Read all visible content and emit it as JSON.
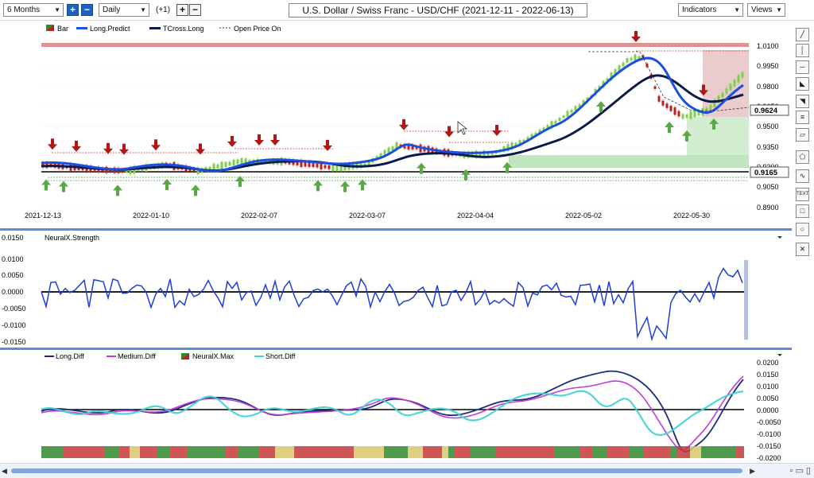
{
  "toolbar": {
    "period": "6 Months",
    "interval": "Daily",
    "offset": "(+1)",
    "title": "U.S. Dollar / Swiss Franc - USD/CHF (2021-12-11 - 2022-06-13)",
    "indicators_label": "Indicators",
    "views_label": "Views"
  },
  "price_pane": {
    "legend": [
      "Bar",
      "Long.Predict",
      "TCross.Long",
      "Open Price On"
    ],
    "y_ticks": [
      "1.0100",
      "0.9950",
      "0.9800",
      "0.9650",
      "0.9500",
      "0.9350",
      "0.9200",
      "0.9050",
      "0.8900"
    ],
    "x_ticks": [
      "2021-12-13",
      "2022-01-10",
      "2022-02-07",
      "2022-03-07",
      "2022-04-04",
      "2022-05-02",
      "2022-05-30"
    ],
    "last_price": "0.9624",
    "ref_price": "0.9165"
  },
  "strength_pane": {
    "legend": "NeuralX.Strength",
    "y_ticks": [
      "0.0150",
      "0.0100",
      "0.0050",
      "0.0000",
      "-0.0050",
      "-0.0100",
      "-0.0150"
    ]
  },
  "diff_pane": {
    "legend": [
      "Long.Diff",
      "Medium.Diff",
      "NeuralX.Max",
      "Short.Diff"
    ],
    "y_ticks": [
      "0.0200",
      "0.0150",
      "0.0100",
      "0.0050",
      "0.0000",
      "-0.0050",
      "-0.0100",
      "-0.0150",
      "-0.0200"
    ]
  },
  "colors": {
    "long_predict": "#1a4fe0",
    "tcross_long": "#0b1a4a",
    "strength": "#1f3fd6",
    "long_diff": "#1c2f78",
    "medium_diff": "#c23cd9",
    "short_diff": "#3fd0d0",
    "up_arrow": "#5aa845",
    "down_arrow": "#b01818",
    "bull_bar": "#7dcf4a",
    "bear_bar": "#c21c1c",
    "ref_line": "#000000"
  },
  "icons": {
    "right_tools": [
      "line-icon",
      "vertical-line-icon",
      "horizontal-line-icon",
      "fill-icon",
      "channel-icon",
      "fib-icon",
      "shape-icon",
      "zigzag-icon",
      "text-icon",
      "rectangle-icon",
      "ellipse-icon",
      "delete-icon"
    ]
  }
}
